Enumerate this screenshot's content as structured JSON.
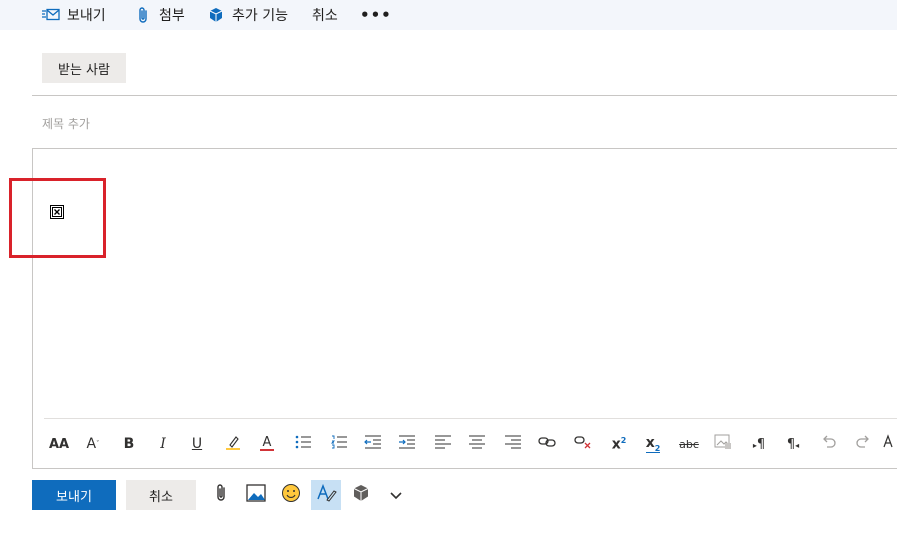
{
  "toolbar": {
    "send_label": "보내기",
    "attach_label": "첨부",
    "addins_label": "추가 기능",
    "cancel_label": "취소",
    "more_label": "•••"
  },
  "recipients": {
    "to_label": "받는 사람"
  },
  "subject": {
    "placeholder": "제목 추가",
    "value": ""
  },
  "format_toolbar": {
    "font_size_label": "AA",
    "grow_label": "A",
    "bold_label": "B",
    "italic_label": "I",
    "underline_label": "U",
    "font_color_label": "A",
    "superscript_label": "x",
    "superscript_sup": "2",
    "subscript_label": "x",
    "subscript_sub": "2",
    "strike_label": "abc",
    "ltr_label": "¶",
    "rtl_label": "¶"
  },
  "actions": {
    "send_label": "보내기",
    "cancel_label": "취소"
  },
  "colors": {
    "accent": "#0f6cbd",
    "highlight_border": "#d9222a",
    "highlighter_yellow": "#ffc83d",
    "font_color_red": "#d13438"
  }
}
